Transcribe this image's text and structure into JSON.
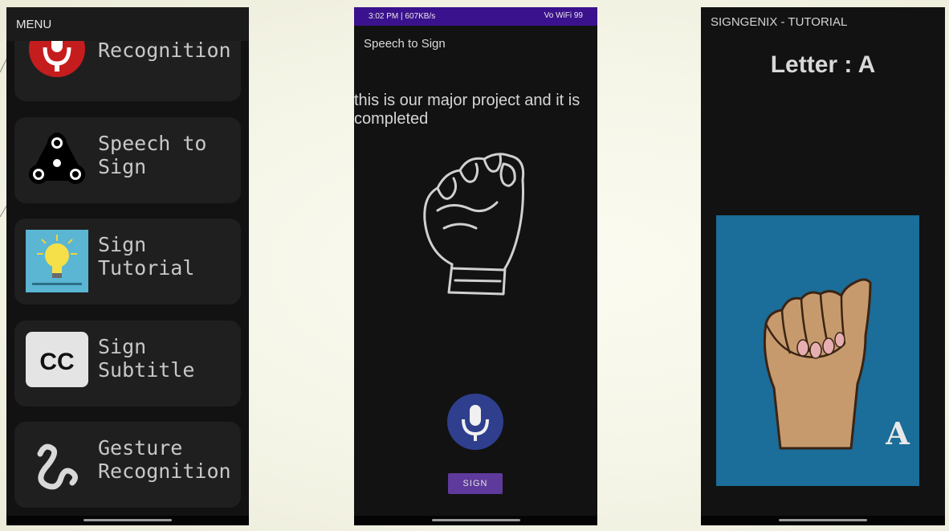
{
  "menu_screen": {
    "header": "MENU",
    "items": [
      {
        "label": "Voice\nRecognition",
        "icon": "microphone-icon"
      },
      {
        "label": "Speech to\nSign",
        "icon": "fidget-spinner-icon"
      },
      {
        "label": "Sign\nTutorial",
        "icon": "lightbulb-icon"
      },
      {
        "label": "Sign\nSubtitle",
        "icon": "cc-icon"
      },
      {
        "label": "Gesture\nRecognition",
        "icon": "gesture-squiggle-icon"
      }
    ],
    "cc_text": "CC"
  },
  "speech_screen": {
    "status_left": "3:02 PM | 607KB/s",
    "status_right": "Vo WiFi 99",
    "title": "Speech to Sign",
    "recognized_text": "this is our major project and it is completed",
    "sign_button": "SIGN",
    "colors": {
      "status_bar": "#3b128d",
      "mic_button": "#2f3f8e",
      "sign_button": "#5e3a9c"
    }
  },
  "tutorial_screen": {
    "title": "SIGNGENIX - TUTORIAL",
    "letter_heading": "Letter : A",
    "image_letter": "A",
    "colors": {
      "image_background": "#1b6d9a",
      "skin": "#c79a6e"
    }
  }
}
